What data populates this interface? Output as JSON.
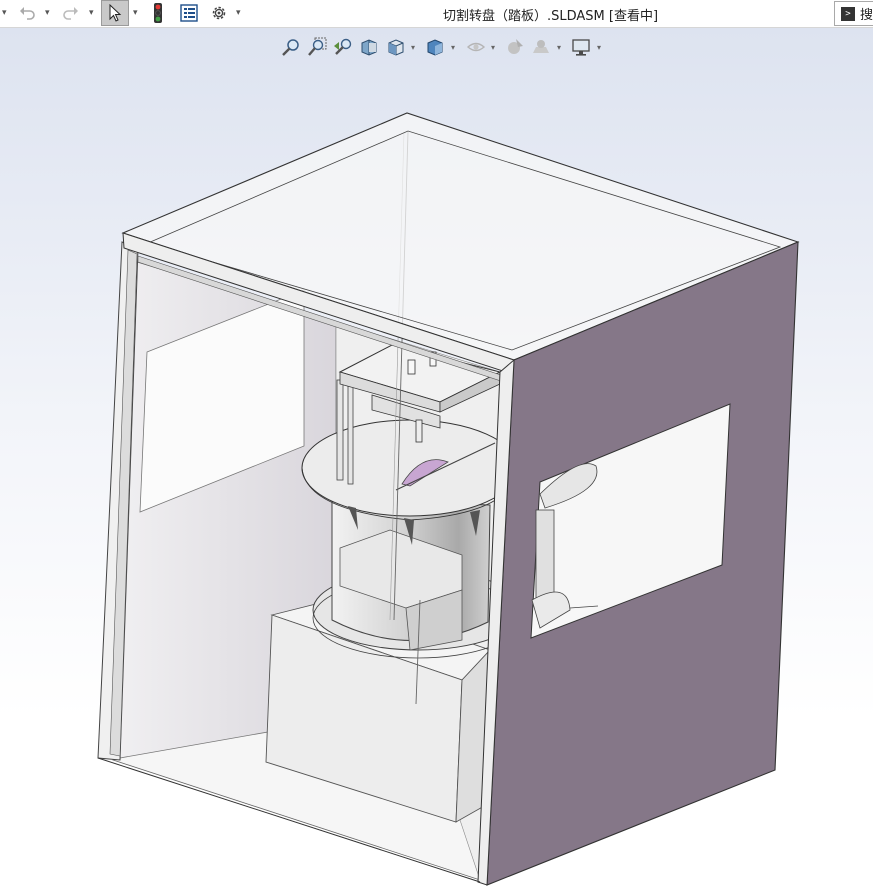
{
  "window": {
    "title": "切割转盘（踏板）.SLDASM [查看中]"
  },
  "search": {
    "label": "搜"
  },
  "toolbar": {
    "icons": [
      "undo-icon",
      "redo-icon",
      "select-pointer-icon",
      "traffic-light-icon",
      "property-list-icon",
      "gear-icon"
    ]
  },
  "view_toolbar": {
    "icons": [
      "zoom-to-fit-icon",
      "zoom-to-area-icon",
      "previous-view-icon",
      "section-view-icon",
      "view-orientation-icon",
      "display-style-icon",
      "hide-show-items-icon",
      "edit-appearance-icon",
      "apply-scene-icon",
      "view-settings-icon"
    ]
  },
  "colors": {
    "viewport_top": "#dde3f0",
    "panel_purple": "#857788",
    "frame_light": "#f4f4f4",
    "blade_purple": "#c8a6d2"
  }
}
